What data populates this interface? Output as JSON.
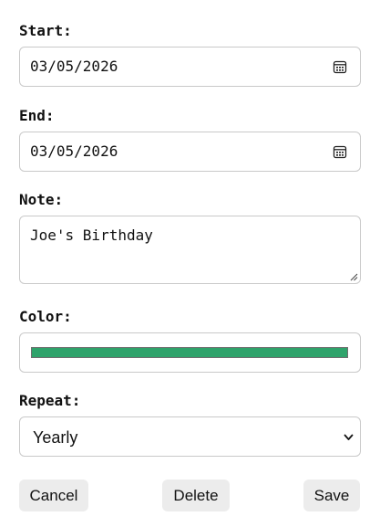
{
  "start": {
    "label": "Start:",
    "value": "03/05/2026",
    "icon": "calendar-icon"
  },
  "end": {
    "label": "End:",
    "value": "03/05/2026",
    "icon": "calendar-icon"
  },
  "note": {
    "label": "Note:",
    "value": "Joe's Birthday"
  },
  "color": {
    "label": "Color:",
    "value": "#2fa36b"
  },
  "repeat": {
    "label": "Repeat:",
    "selected": "Yearly",
    "icon": "chevron-down-icon"
  },
  "buttons": {
    "cancel": "Cancel",
    "delete": "Delete",
    "save": "Save"
  },
  "colors": {
    "border": "#c9c9c9",
    "button_bg": "#ececec"
  }
}
